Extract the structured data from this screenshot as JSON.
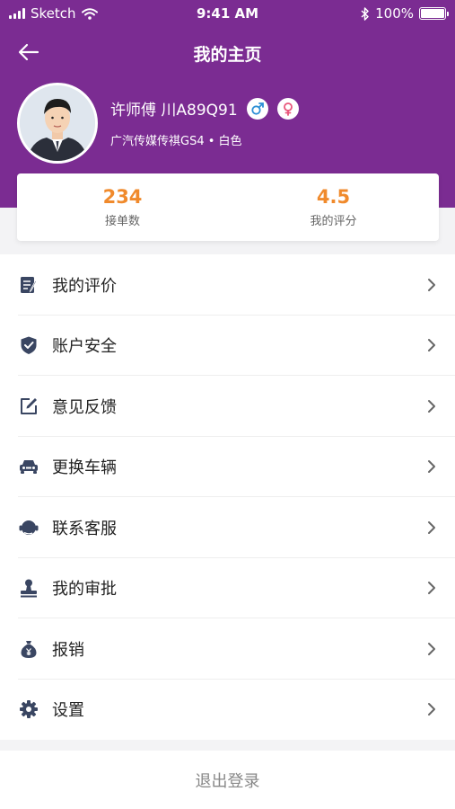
{
  "status_bar": {
    "carrier": "Sketch",
    "time": "9:41 AM",
    "battery": "100%"
  },
  "nav": {
    "title": "我的主页",
    "back_icon": "arrow-left-icon"
  },
  "profile": {
    "name_plate": "许师傅 川A89Q91",
    "car": "广汽传媒传祺GS4 • 白色",
    "male_icon_color": "#2d8fd6",
    "female_icon_color": "#e8557a"
  },
  "stats": {
    "orders_value": "234",
    "orders_label": "接单数",
    "rating_value": "4.5",
    "rating_label": "我的评分"
  },
  "menu": {
    "items": [
      {
        "label": "我的评价",
        "icon": "review-icon"
      },
      {
        "label": "账户安全",
        "icon": "shield-icon"
      },
      {
        "label": "意见反馈",
        "icon": "edit-icon"
      },
      {
        "label": "更换车辆",
        "icon": "car-icon"
      },
      {
        "label": "联系客服",
        "icon": "headset-icon"
      },
      {
        "label": "我的审批",
        "icon": "stamp-icon"
      },
      {
        "label": "报销",
        "icon": "money-bag-icon"
      },
      {
        "label": "设置",
        "icon": "gear-icon"
      }
    ]
  },
  "logout_label": "退出登录",
  "colors": {
    "header_bg": "#7b2c92",
    "accent_orange": "#f08a2c",
    "icon_dark": "#3a4662"
  }
}
